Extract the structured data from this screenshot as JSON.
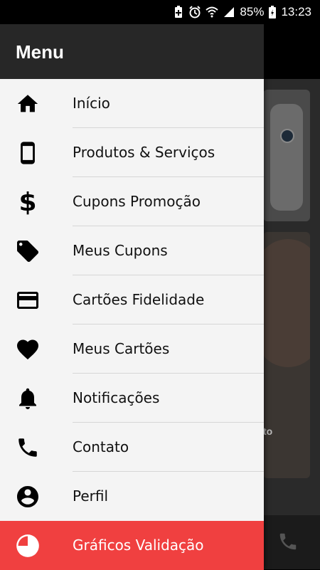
{
  "status_bar": {
    "battery": "85%",
    "time": "13:23"
  },
  "background": {
    "card_caption": "to"
  },
  "drawer": {
    "title": "Menu",
    "items": [
      {
        "label": "Início",
        "icon": "home-icon"
      },
      {
        "label": "Produtos & Serviços",
        "icon": "smartphone-icon"
      },
      {
        "label": "Cupons Promoção",
        "icon": "dollar-icon"
      },
      {
        "label": "Meus Cupons",
        "icon": "tags-icon"
      },
      {
        "label": "Cartões Fidelidade",
        "icon": "credit-card-icon"
      },
      {
        "label": "Meus Cartões",
        "icon": "heart-icon"
      },
      {
        "label": "Notificações",
        "icon": "bell-icon"
      },
      {
        "label": "Contato",
        "icon": "phone-icon"
      },
      {
        "label": "Perfil",
        "icon": "account-circle-icon"
      },
      {
        "label": "Gráficos Validação",
        "icon": "pie-chart-icon",
        "active": true
      }
    ]
  },
  "colors": {
    "header": "#272727",
    "drawer_bg": "#f4f4f4",
    "active": "#f04040"
  }
}
